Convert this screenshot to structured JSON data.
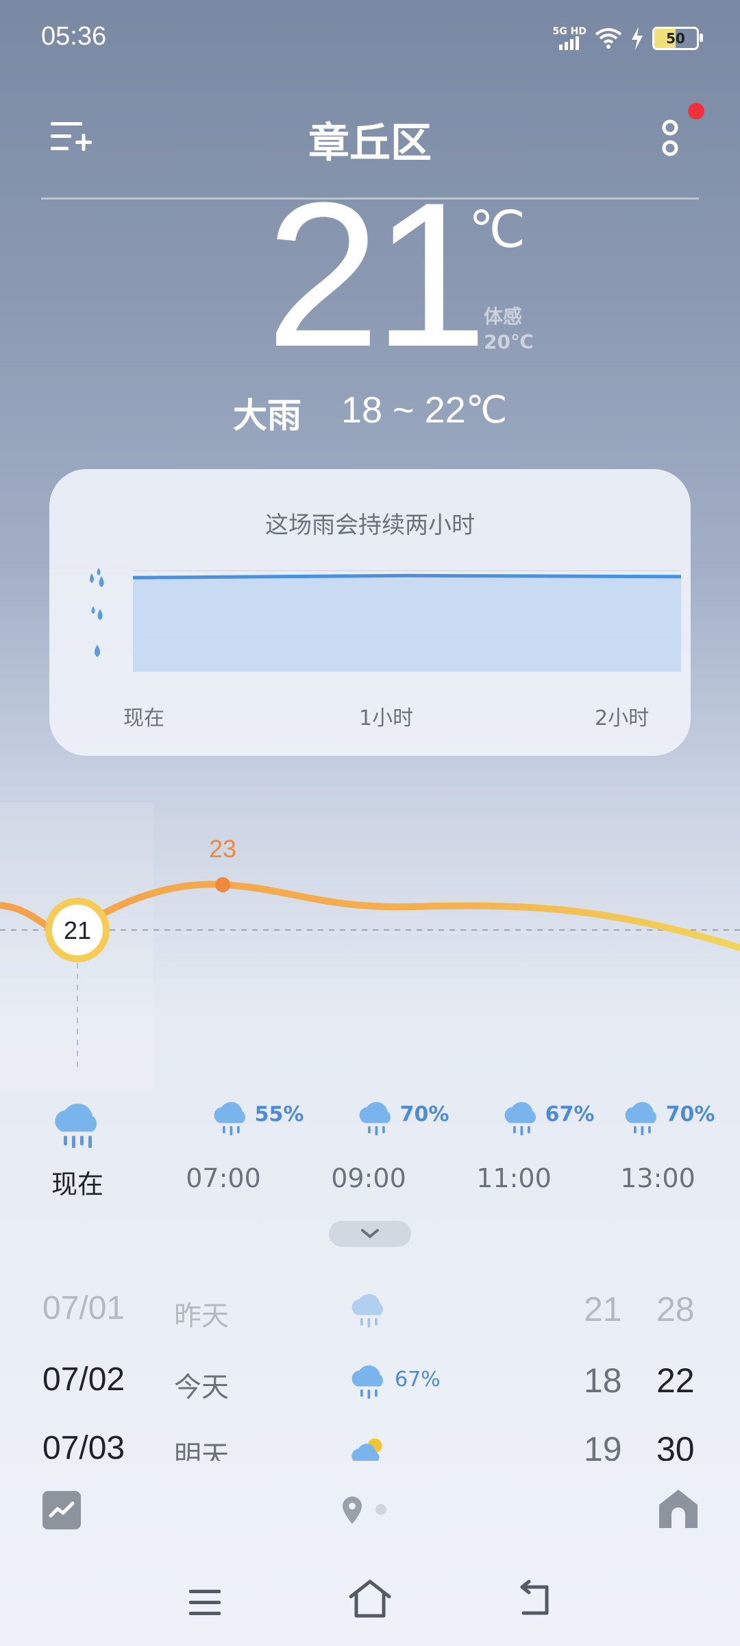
{
  "status_bar": {
    "time": "05:36",
    "network": "5G HD",
    "battery": "50"
  },
  "header": {
    "location": "章丘区",
    "left_icon": "city-list-add-icon",
    "right_icon": "more-options-icon",
    "has_notification_dot": true
  },
  "current": {
    "temperature": "21",
    "unit": "℃",
    "feels_like_label": "体感",
    "feels_like_value": "20℃",
    "condition": "大雨",
    "range": "18 ~ 22℃"
  },
  "rain_card": {
    "title": "这场雨会持续两小时",
    "x_labels": [
      "现在",
      "1小时",
      "2小时"
    ],
    "intensity_icons": [
      "heavy-rain-drops-icon",
      "moderate-rain-drops-icon",
      "light-rain-drop-icon"
    ]
  },
  "chart_data": {
    "type": "area",
    "title": "这场雨会持续两小时",
    "x": [
      "现在",
      "1小时",
      "2小时"
    ],
    "series": [
      {
        "values": [
          0.93,
          0.95,
          0.94
        ]
      }
    ],
    "ylim": [
      0,
      1
    ],
    "grid": true
  },
  "hourly": {
    "current_temp_label": "21",
    "peak_temp_label": "23",
    "temps": [
      21,
      23,
      22,
      22,
      21
    ],
    "items": [
      {
        "time": "现在",
        "pct": "",
        "icon": "heavy-rain-cloud-icon"
      },
      {
        "time": "07:00",
        "pct": "55%",
        "icon": "rain-cloud-icon"
      },
      {
        "time": "09:00",
        "pct": "70%",
        "icon": "rain-cloud-icon"
      },
      {
        "time": "11:00",
        "pct": "67%",
        "icon": "rain-cloud-icon"
      },
      {
        "time": "13:00",
        "pct": "70%",
        "icon": "rain-cloud-icon"
      }
    ]
  },
  "daily": [
    {
      "date": "07/01",
      "name": "昨天",
      "icon": "rain-cloud-icon",
      "pct": "",
      "low": "21",
      "high": "28"
    },
    {
      "date": "07/02",
      "name": "今天",
      "icon": "rain-cloud-icon",
      "pct": "67%",
      "low": "18",
      "high": "22"
    },
    {
      "date": "07/03",
      "name": "明天",
      "icon": "partly-cloudy-icon",
      "pct": "",
      "low": "19",
      "high": "30"
    }
  ],
  "colors": {
    "accent_blue": "#4d8bd6",
    "temp_orange": "#f5a24a",
    "peak_orange": "#f08a3a"
  }
}
